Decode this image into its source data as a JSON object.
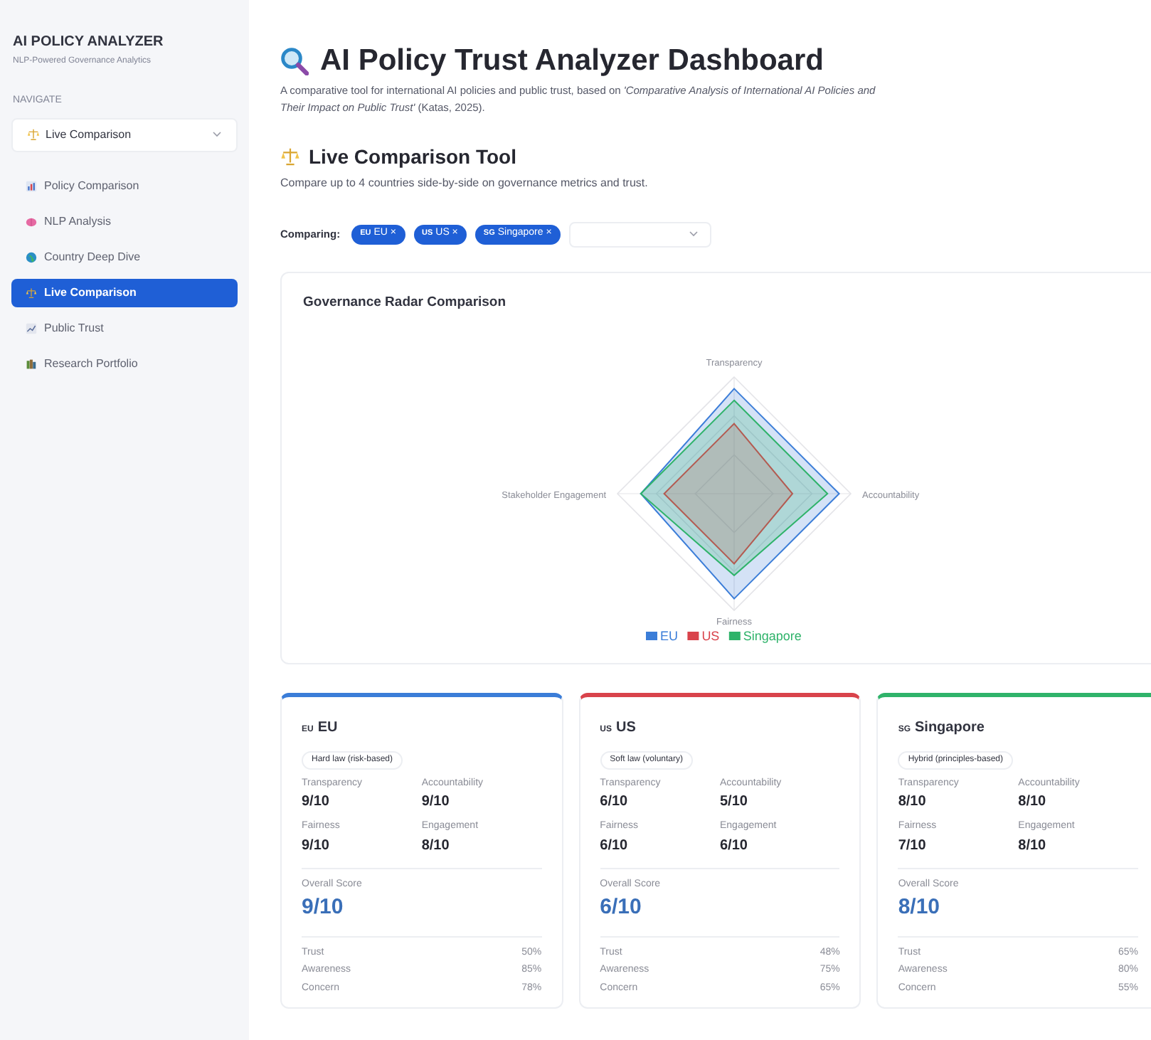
{
  "sidebar": {
    "title": "AI POLICY ANALYZER",
    "subtitle": "NLP-Powered Governance Analytics",
    "nav_label": "NAVIGATE",
    "dropdown": {
      "value": "Live Comparison",
      "kind": "scales"
    },
    "items": [
      {
        "label": "Policy Comparison",
        "kind": "chart",
        "selected": false
      },
      {
        "label": "NLP Analysis",
        "kind": "brain",
        "selected": false
      },
      {
        "label": "Country Deep Dive",
        "kind": "globe",
        "selected": false
      },
      {
        "label": "Live Comparison",
        "kind": "scales",
        "selected": true
      },
      {
        "label": "Public Trust",
        "kind": "trend",
        "selected": false
      },
      {
        "label": "Research Portfolio",
        "kind": "books",
        "selected": false
      }
    ]
  },
  "header": {
    "title": "AI Policy Trust Analyzer Dashboard",
    "description": "A comparative tool for international AI policies and public trust, based on *'Comparative Analysis of International AI Policies and Their Impact on Public Trust'* (Katas, 2025)."
  },
  "section": {
    "title": "Live Comparison Tool",
    "description": "Compare up to 4 countries side-by-side on governance metrics and trust."
  },
  "comparing": {
    "label": "Comparing:",
    "chips": [
      {
        "flag": "EU",
        "name": "EU",
        "remove": "×"
      },
      {
        "flag": "US",
        "name": "US",
        "remove": "×"
      },
      {
        "flag": "SG",
        "name": "Singapore",
        "remove": "×"
      }
    ]
  },
  "radar": {
    "title": "Governance Radar Comparison",
    "axes": [
      "Transparency",
      "Accountability",
      "Fairness",
      "Stakeholder Engagement"
    ],
    "legend": [
      {
        "name": "EU",
        "color": "#3b7dd8"
      },
      {
        "name": "US",
        "color": "#d9434b"
      },
      {
        "name": "Singapore",
        "color": "#2fb36a"
      }
    ]
  },
  "cards": [
    {
      "flag": "EU",
      "name": "EU",
      "color": "#3b7dd8",
      "badge": "Hard law (risk-based)",
      "metrics": [
        {
          "label": "Transparency",
          "value": "9/10"
        },
        {
          "label": "Accountability",
          "value": "9/10"
        },
        {
          "label": "Fairness",
          "value": "9/10"
        },
        {
          "label": "Engagement",
          "value": "8/10"
        }
      ],
      "overall_label": "Overall Score",
      "overall": "9/10",
      "stats": [
        {
          "label": "Trust",
          "value": "50%"
        },
        {
          "label": "Awareness",
          "value": "85%"
        },
        {
          "label": "Concern",
          "value": "78%"
        }
      ]
    },
    {
      "flag": "US",
      "name": "US",
      "color": "#d9434b",
      "badge": "Soft law (voluntary)",
      "metrics": [
        {
          "label": "Transparency",
          "value": "6/10"
        },
        {
          "label": "Accountability",
          "value": "5/10"
        },
        {
          "label": "Fairness",
          "value": "6/10"
        },
        {
          "label": "Engagement",
          "value": "6/10"
        }
      ],
      "overall_label": "Overall Score",
      "overall": "6/10",
      "stats": [
        {
          "label": "Trust",
          "value": "48%"
        },
        {
          "label": "Awareness",
          "value": "75%"
        },
        {
          "label": "Concern",
          "value": "65%"
        }
      ]
    },
    {
      "flag": "SG",
      "name": "Singapore",
      "color": "#2fb36a",
      "badge": "Hybrid (principles-based)",
      "metrics": [
        {
          "label": "Transparency",
          "value": "8/10"
        },
        {
          "label": "Accountability",
          "value": "8/10"
        },
        {
          "label": "Fairness",
          "value": "7/10"
        },
        {
          "label": "Engagement",
          "value": "8/10"
        }
      ],
      "overall_label": "Overall Score",
      "overall": "8/10",
      "stats": [
        {
          "label": "Trust",
          "value": "65%"
        },
        {
          "label": "Awareness",
          "value": "80%"
        },
        {
          "label": "Concern",
          "value": "55%"
        }
      ]
    }
  ]
}
